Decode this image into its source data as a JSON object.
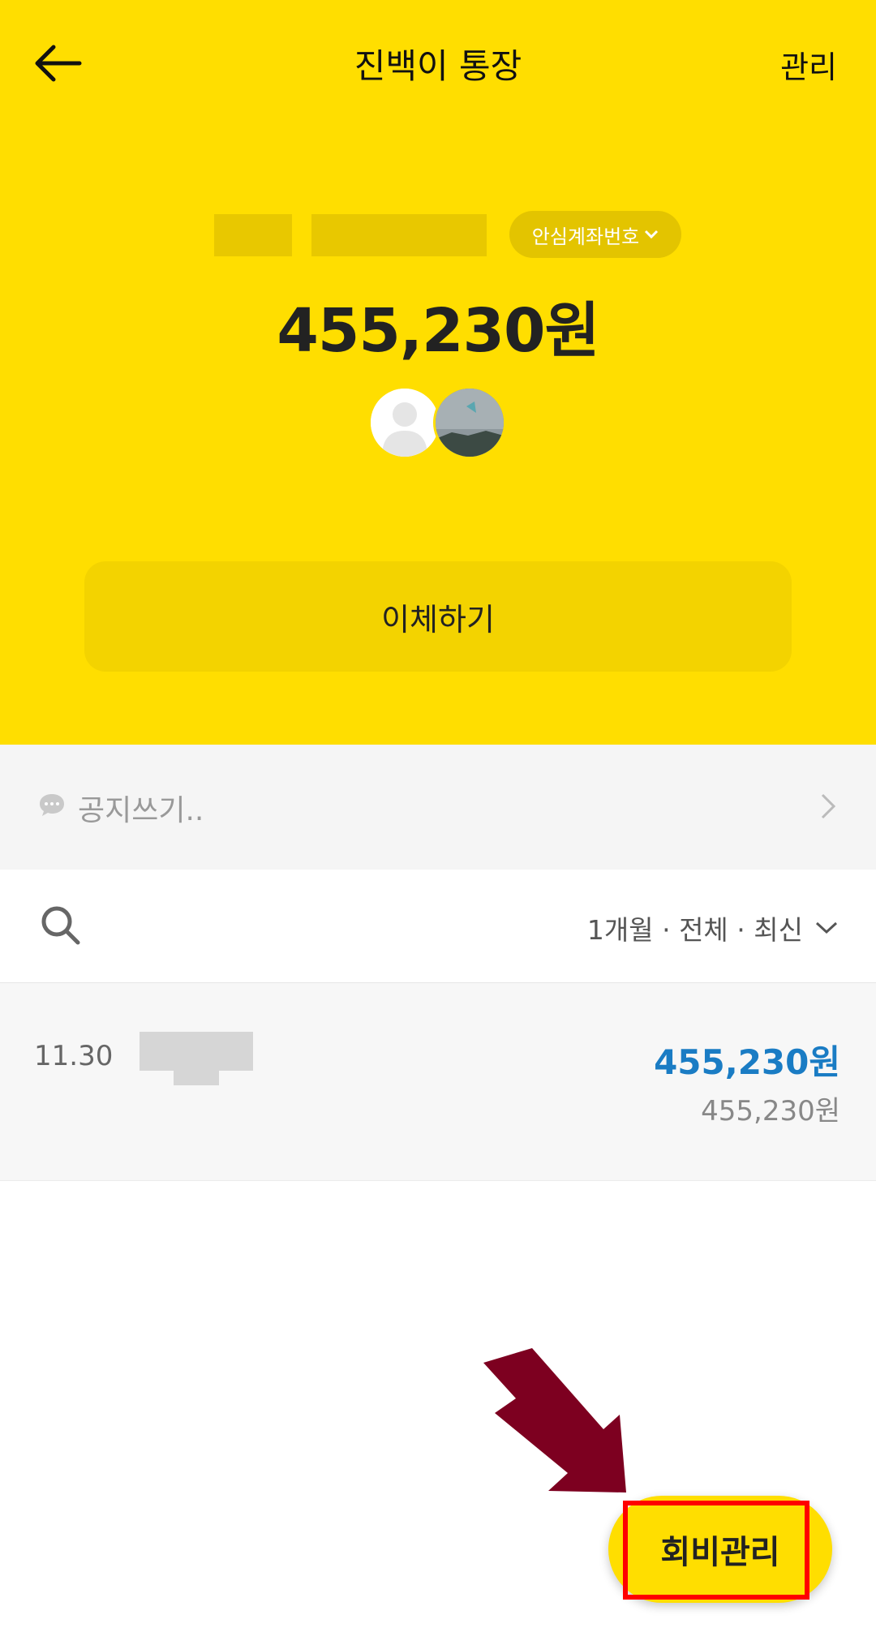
{
  "header": {
    "title": "진백이 통장",
    "manage_label": "관리"
  },
  "account": {
    "safe_number_label": "안심계좌번호",
    "balance": "455,230원"
  },
  "actions": {
    "transfer_label": "이체하기",
    "fee_manage_label": "회비관리"
  },
  "notice": {
    "placeholder": "공지쓰기.."
  },
  "filter": {
    "label": "1개월 · 전체 · 최신"
  },
  "transactions": [
    {
      "date": "11.30",
      "amount": "455,230원",
      "balance_after": "455,230원"
    }
  ],
  "colors": {
    "brand_yellow": "#FFDE00",
    "amount_blue": "#1a7cc4",
    "annotation_red": "#ff0000",
    "annotation_arrow": "#7d0020"
  }
}
